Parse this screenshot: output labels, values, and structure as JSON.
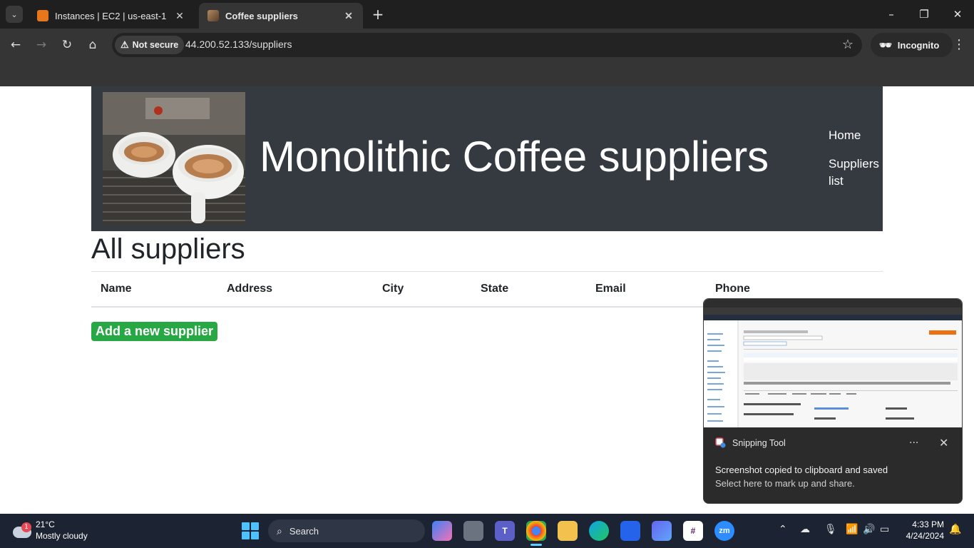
{
  "browser": {
    "tabs": [
      {
        "title": "Instances | EC2 | us-east-1",
        "favicon": "aws-icon",
        "color": "#e8761b"
      },
      {
        "title": "Coffee suppliers",
        "favicon": "coffee-icon",
        "color": "#8a6a4a"
      }
    ],
    "close_glyph": "✕",
    "new_tab_glyph": "+",
    "security_label": "Not secure",
    "url": "44.200.52.133/suppliers",
    "incognito_label": "Incognito"
  },
  "site": {
    "title": "Monolithic Coffee suppliers",
    "nav": {
      "home": "Home",
      "suppliers_list": "Suppliers list"
    },
    "header_bg": "#343a40"
  },
  "main": {
    "heading": "All suppliers",
    "table": {
      "columns": [
        "Name",
        "Address",
        "City",
        "State",
        "Email",
        "Phone"
      ],
      "rows": []
    },
    "add_button": "Add a new supplier",
    "add_button_color": "#28a745"
  },
  "notification": {
    "app": "Snipping Tool",
    "more_glyph": "···",
    "close_glyph": "✕",
    "title": "Screenshot copied to clipboard and saved",
    "body": "Select here to mark up and share."
  },
  "taskbar": {
    "weather_badge": "1",
    "temperature": "21°C",
    "condition": "Mostly cloudy",
    "search_placeholder": "Search",
    "time": "4:33 PM",
    "date": "4/24/2024"
  }
}
